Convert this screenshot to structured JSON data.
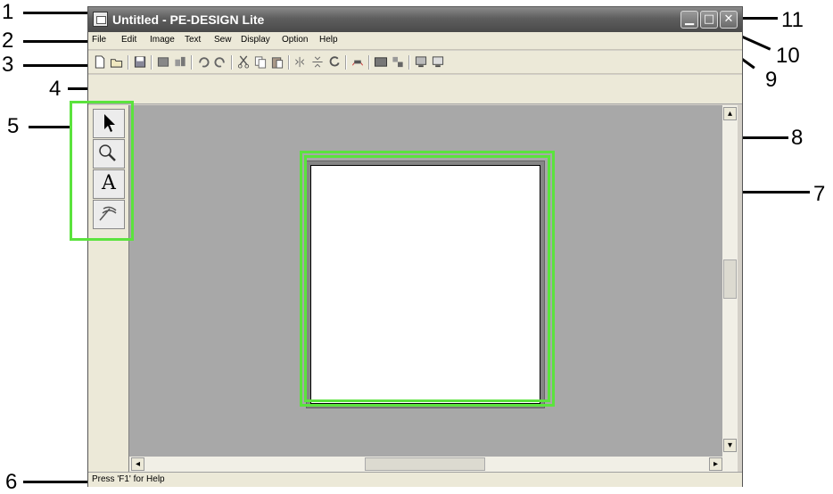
{
  "window": {
    "title": "Untitled - PE-DESIGN Lite",
    "minimize_glyph": "▁",
    "maximize_glyph": "□",
    "close_glyph": "✕"
  },
  "menu": {
    "items": [
      "File",
      "Edit",
      "Image",
      "Text",
      "Sew",
      "Display",
      "Option",
      "Help"
    ]
  },
  "toolbar": {
    "icons": [
      "new-icon",
      "open-icon",
      "save-icon",
      "import-image-icon",
      "transfer-icon",
      "undo-icon",
      "redo-icon",
      "cut-icon",
      "copy-icon",
      "paste-icon",
      "mirror-horizontal-icon",
      "mirror-vertical-icon",
      "rotate-icon",
      "text-arc-icon",
      "design-property-icon",
      "design-center-icon",
      "preview-icon",
      "realistic-preview-icon"
    ]
  },
  "toolbox": {
    "tools": [
      "select-arrow-icon",
      "zoom-icon",
      "text-tool-icon",
      "stitch-tool-icon"
    ],
    "text_tool_glyph": "A"
  },
  "status": {
    "text": "Press 'F1' for Help"
  },
  "callouts": {
    "n1": "1",
    "n2": "2",
    "n3": "3",
    "n4": "4",
    "n5": "5",
    "n6": "6",
    "n7": "7",
    "n8": "8",
    "n9": "9",
    "n10": "10",
    "n11": "11"
  },
  "colors": {
    "highlight": "#5be33d",
    "workarea": "#a8a8a8",
    "titlebar": "#5e5e5e"
  }
}
